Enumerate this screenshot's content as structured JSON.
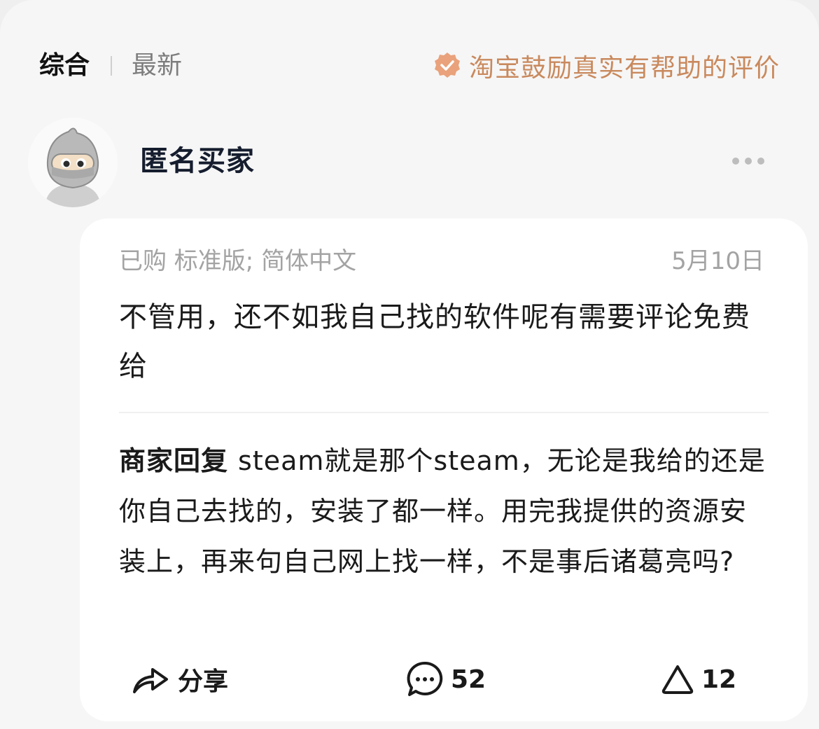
{
  "tabs": {
    "all": "综合",
    "latest": "最新"
  },
  "badge": {
    "text": "淘宝鼓励真实有帮助的评价",
    "icon": "verified-badge-icon",
    "color": "#e8a27a"
  },
  "user": {
    "name": "匿名买家",
    "avatar": "anonymous-ninja-avatar"
  },
  "review": {
    "purchased": "已购 标准版; 简体中文",
    "date": "5月10日",
    "text": "不管用，还不如我自己找的软件呢有需要评论免费给"
  },
  "reply": {
    "label": "商家回复",
    "text": "steam就是那个steam，无论是我给的还是你自己去找的，安装了都一样。用完我提供的资源安装上，再来句自己网上找一样，不是事后诸葛亮吗?"
  },
  "actions": {
    "share": "分享",
    "comments": "52",
    "likes": "12"
  }
}
